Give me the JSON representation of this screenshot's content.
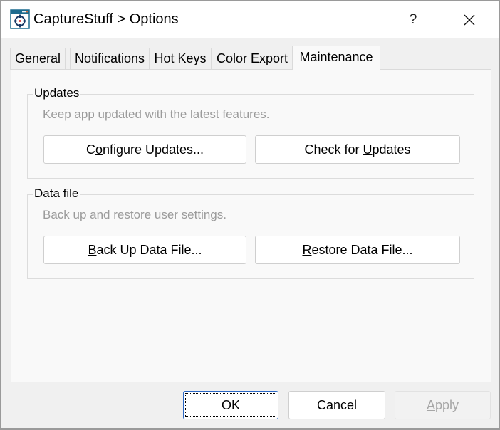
{
  "window": {
    "title": "CaptureStuff > Options",
    "app_icon": "crosshair-target-icon",
    "help_label": "?",
    "close_icon": "close-icon"
  },
  "tabs": [
    {
      "label": "General",
      "active": false
    },
    {
      "label": "Notifications",
      "active": false
    },
    {
      "label": "Hot Keys",
      "active": false
    },
    {
      "label": "Color Export",
      "active": false
    },
    {
      "label": "Maintenance",
      "active": true
    }
  ],
  "groups": {
    "updates": {
      "title": "Updates",
      "description": "Keep app updated with the latest features.",
      "configure_button": {
        "pre": "C",
        "mnemonic": "o",
        "post": "nfigure Updates..."
      },
      "check_button": {
        "pre": "Check for ",
        "mnemonic": "U",
        "post": "pdates"
      }
    },
    "data_file": {
      "title": "Data file",
      "description": "Back up and restore user settings.",
      "backup_button": {
        "pre": "",
        "mnemonic": "B",
        "post": "ack Up Data File..."
      },
      "restore_button": {
        "pre": "",
        "mnemonic": "R",
        "post": "estore Data File..."
      }
    }
  },
  "footer": {
    "ok_label": "OK",
    "cancel_label": "Cancel",
    "apply_button": {
      "pre": "",
      "mnemonic": "A",
      "post": "pply",
      "disabled": true
    }
  }
}
